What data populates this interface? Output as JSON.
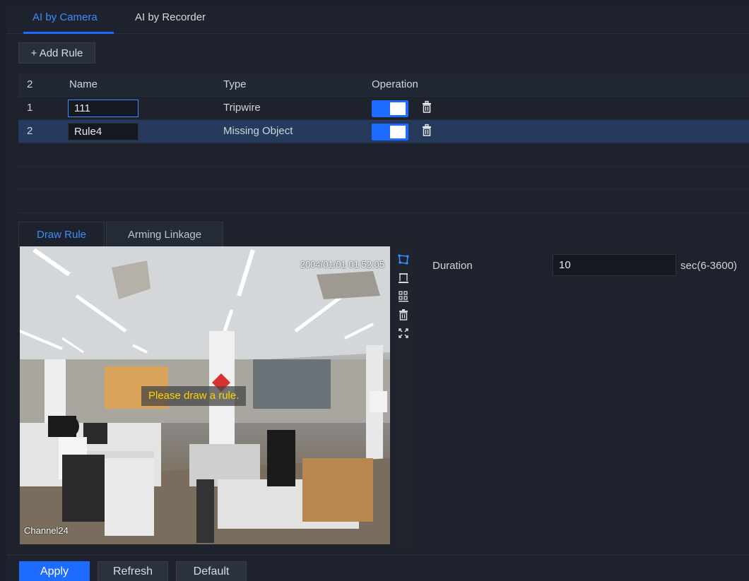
{
  "tabs": {
    "ai_by_camera": "AI by Camera",
    "ai_by_recorder": "AI by Recorder"
  },
  "toolbar": {
    "add_rule_label": "+ Add Rule"
  },
  "table": {
    "headers": {
      "count": "2",
      "name": "Name",
      "type": "Type",
      "operation": "Operation"
    },
    "rows": [
      {
        "index": "1",
        "name": "111",
        "type": "Tripwire",
        "enabled": true
      },
      {
        "index": "2",
        "name": "Rule4",
        "type": "Missing Object",
        "enabled": true
      }
    ]
  },
  "sub_tabs": {
    "draw_rule": "Draw Rule",
    "arming_linkage": "Arming Linkage"
  },
  "video": {
    "timestamp": "2004/01/01 01:52:05",
    "channel": "Channel24",
    "hint": "Please draw a rule."
  },
  "tools": [
    "draw-region-icon",
    "draw-min-size-icon",
    "draw-max-size-icon",
    "delete-icon",
    "fullscreen-icon"
  ],
  "settings": {
    "duration_label": "Duration",
    "duration_value": "10",
    "duration_unit": "sec(6-3600)"
  },
  "buttons": {
    "apply": "Apply",
    "refresh": "Refresh",
    "default": "Default"
  },
  "colors": {
    "accent": "#1e6bff",
    "hint_text": "#ffd200",
    "background": "#1b202a"
  }
}
